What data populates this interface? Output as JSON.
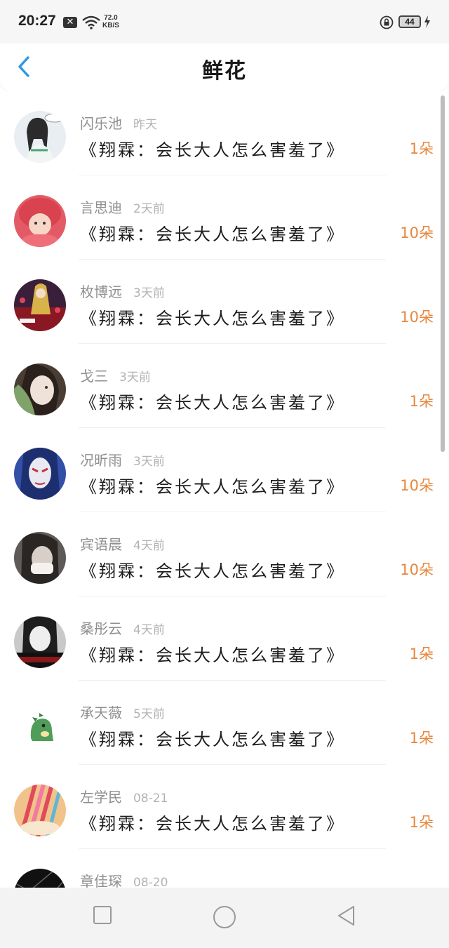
{
  "status_bar": {
    "time": "20:27",
    "notification_x": "✕",
    "net_speed_value": "72.0",
    "net_speed_unit": "KB/S",
    "battery_level": "44"
  },
  "header": {
    "title": "鲜花"
  },
  "records": [
    {
      "name": "闪乐池",
      "time": "昨天",
      "book": "《翔霖：会长大人怎么害羞了》",
      "count": "1朵",
      "avatar_color": "#e9eef3",
      "avatar_accent": "#2b2b2b"
    },
    {
      "name": "言思迪",
      "time": "2天前",
      "book": "《翔霖：会长大人怎么害羞了》",
      "count": "10朵",
      "avatar_color": "#e35a66",
      "avatar_accent": "#f7d6c8"
    },
    {
      "name": "枚博远",
      "time": "3天前",
      "book": "《翔霖：会长大人怎么害羞了》",
      "count": "10朵",
      "avatar_color": "#3a1f3b",
      "avatar_accent": "#d8b34a"
    },
    {
      "name": "戈三",
      "time": "3天前",
      "book": "《翔霖：会长大人怎么害羞了》",
      "count": "1朵",
      "avatar_color": "#4a3e34",
      "avatar_accent": "#7fa36a"
    },
    {
      "name": "况昕雨",
      "time": "3天前",
      "book": "《翔霖：会长大人怎么害羞了》",
      "count": "10朵",
      "avatar_color": "#3350a8",
      "avatar_accent": "#e9e9f2"
    },
    {
      "name": "宾语晨",
      "time": "4天前",
      "book": "《翔霖：会长大人怎么害羞了》",
      "count": "10朵",
      "avatar_color": "#5e5a58",
      "avatar_accent": "#d8cfc8"
    },
    {
      "name": "桑彤云",
      "time": "4天前",
      "book": "《翔霖：会长大人怎么害羞了》",
      "count": "1朵",
      "avatar_color": "#c9c9c9",
      "avatar_accent": "#1e1e1e"
    },
    {
      "name": "承天薇",
      "time": "5天前",
      "book": "《翔霖：会长大人怎么害羞了》",
      "count": "1朵",
      "avatar_color": "#ffffff",
      "avatar_accent": "#4f9d58"
    },
    {
      "name": "左学民",
      "time": "08-21",
      "book": "《翔霖：会长大人怎么害羞了》",
      "count": "1朵",
      "avatar_color": "#f1c38a",
      "avatar_accent": "#e04a5b"
    },
    {
      "name": "章佳琛",
      "time": "08-20",
      "book": "",
      "count": "",
      "avatar_color": "#111111",
      "avatar_accent": "#666666"
    }
  ],
  "icons": {
    "back": "chevron-left-icon",
    "nav_recent": "square-icon",
    "nav_home": "circle-icon",
    "nav_back": "triangle-back-icon"
  },
  "colors": {
    "accent_blue": "#2f97e6",
    "count_orange": "#e8863a"
  }
}
